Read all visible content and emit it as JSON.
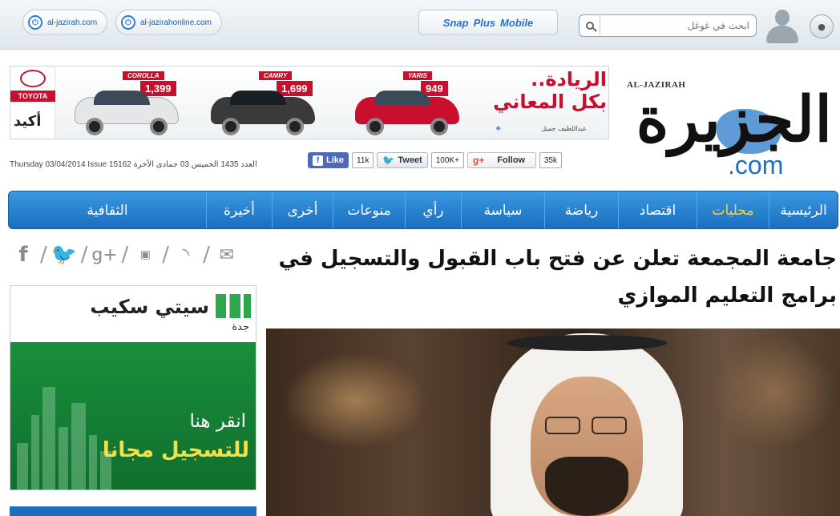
{
  "topbar": {
    "domains": [
      "al-jazirah.com",
      "al-jazirahonline.com"
    ],
    "snap_items": [
      "Snap",
      "Plus",
      "Mobile"
    ],
    "search_placeholder": "ابحث في غوغل"
  },
  "ad": {
    "brand": "TOYOTA",
    "brand_tag": "أكيد",
    "cars": [
      {
        "model": "COROLLA",
        "price": "1,399",
        "color": "#e8e8e8"
      },
      {
        "model": "CAMRY",
        "price": "1,699",
        "color": "#3a3a3a"
      },
      {
        "model": "YARIS",
        "price": "949",
        "color": "#c8102e"
      }
    ],
    "tagline_1": "الريادة..",
    "tagline_2": "بكل المعاني",
    "sponsor": "عبداللطيف جميل"
  },
  "logo": {
    "latin": "AL-JAZIRAH",
    "arabic": "الجزيرة",
    "dotcom": ".com"
  },
  "dateline": "Thursday 03/04/2014 Issue 15162 العدد 1435 الخميس 03 جمادى الآخرة",
  "social": {
    "fb_label": "Like",
    "fb_count": "11k",
    "tw_label": "Tweet",
    "tw_count": "100K+",
    "gp_label": "Follow",
    "gp_count": "35k"
  },
  "nav": {
    "items": [
      "الرئيسية",
      "محليات",
      "اقتصاد",
      "رياضة",
      "سياسة",
      "رأي",
      "منوعات",
      "أخرى",
      "أخيرة",
      "الثقافية"
    ],
    "active_index": 1
  },
  "share_icons": [
    "facebook-icon",
    "twitter-icon",
    "googleplus-icon",
    "youtube-icon",
    "rss-icon",
    "email-icon"
  ],
  "city_ad": {
    "name": "سيتي سكيب",
    "city": "جدة",
    "cta_1": "انقر هنا",
    "cta_2": "للتسجيل مجانا"
  },
  "article": {
    "headline": "جامعة المجمعة تعلن عن فتح باب القبول والتسجيل في برامج التعليم الموازي"
  }
}
